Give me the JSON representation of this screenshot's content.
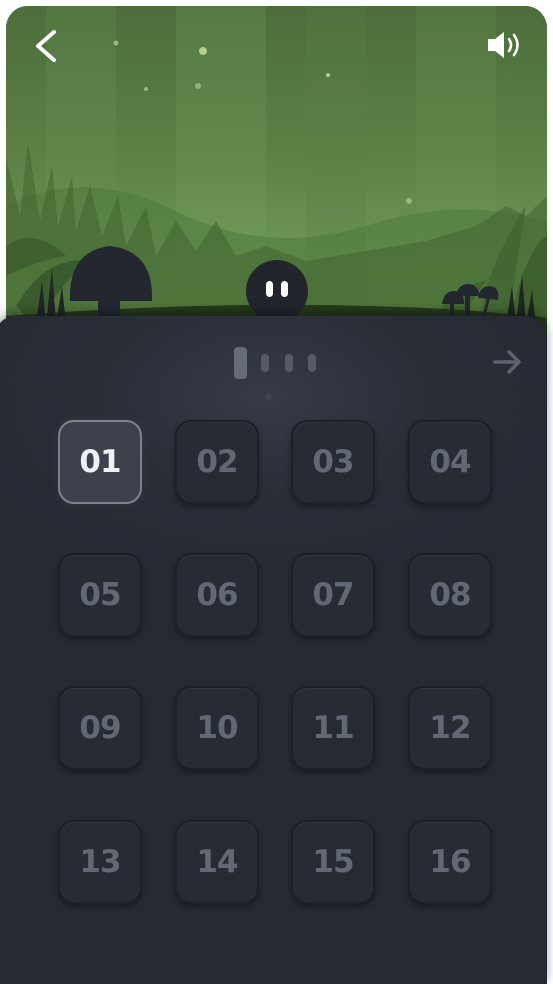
{
  "header": {
    "back_icon": "chevron-left-icon",
    "sound_icon": "speaker-volume-icon"
  },
  "pager": {
    "total_pages": 4,
    "current_page": 1,
    "next_icon": "arrow-right-icon"
  },
  "levels": [
    {
      "label": "01",
      "selected": true
    },
    {
      "label": "02"
    },
    {
      "label": "03"
    },
    {
      "label": "04"
    },
    {
      "label": "05"
    },
    {
      "label": "06"
    },
    {
      "label": "07"
    },
    {
      "label": "08"
    },
    {
      "label": "09"
    },
    {
      "label": "10"
    },
    {
      "label": "11"
    },
    {
      "label": "12"
    },
    {
      "label": "13"
    },
    {
      "label": "14"
    },
    {
      "label": "15"
    },
    {
      "label": "16"
    }
  ],
  "colors": {
    "forest_green": "#5b8146",
    "panel_dark": "#262a33",
    "tile_text": "#626874",
    "tile_selected_text": "#eef0f3"
  }
}
